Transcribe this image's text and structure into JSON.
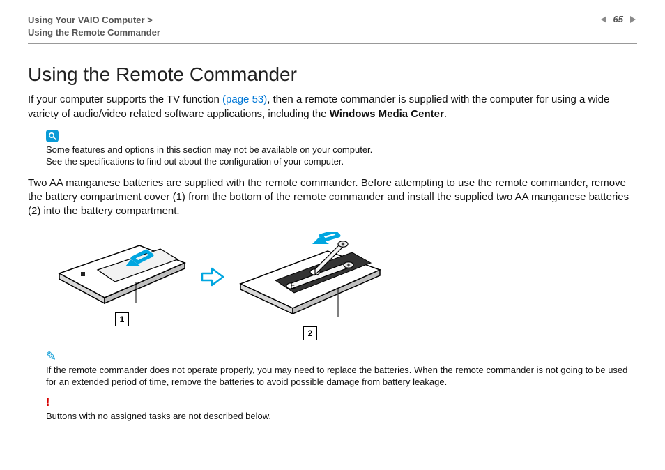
{
  "header": {
    "breadcrumb_top": "Using Your VAIO Computer",
    "breadcrumb_sep": ">",
    "breadcrumb_sub": "Using the Remote Commander",
    "page_number": "65"
  },
  "content": {
    "title": "Using the Remote Commander",
    "intro_pre": "If your computer supports the TV function ",
    "intro_link": "(page 53)",
    "intro_post": ", then a remote commander is supplied with the computer for using a wide variety of audio/video related software applications, including the ",
    "intro_bold": "Windows Media Center",
    "intro_end": ".",
    "note1_line1": "Some features and options in this section may not be available on your computer.",
    "note1_line2": "See the specifications to find out about the configuration of your computer.",
    "para2": "Two AA manganese batteries are supplied with the remote commander. Before attempting to use the remote commander, remove the battery compartment cover (1) from the bottom of the remote commander and install the supplied two AA manganese batteries (2) into the battery compartment.",
    "fig_label_1": "1",
    "fig_label_2": "2",
    "note2": "If the remote commander does not operate properly, you may need to replace the batteries. When the remote commander is not going to be used for an extended period of time, remove the batteries to avoid possible damage from battery leakage.",
    "warn": "Buttons with no assigned tasks are not described below."
  }
}
